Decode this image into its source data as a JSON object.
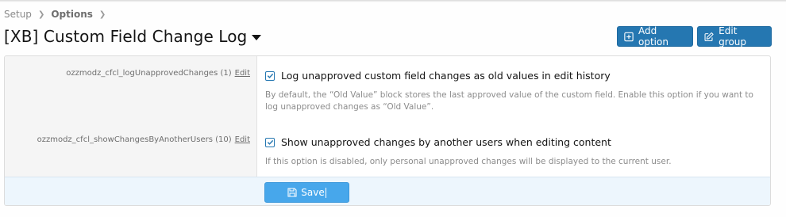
{
  "breadcrumb": {
    "items": [
      "Setup",
      "Options"
    ]
  },
  "header": {
    "title": "[XB] Custom Field Change Log"
  },
  "actions": {
    "add_option": "Add option",
    "edit_group": "Edit group"
  },
  "options": [
    {
      "key": "ozzmodz_cfcl_logUnapprovedChanges (1)",
      "edit_label": "Edit",
      "checked": true,
      "label": "Log unapproved custom field changes as old values in edit history",
      "explain": "By default, the “Old Value” block stores the last approved value of the custom field. Enable this option if you want to log unapproved changes as “Old Value”."
    },
    {
      "key": "ozzmodz_cfcl_showChangesByAnotherUsers (10)",
      "edit_label": "Edit",
      "checked": true,
      "label": "Show unapproved changes by another users when editing content",
      "explain": "If this option is disabled, only personal unapproved changes will be displayed to the current user."
    }
  ],
  "footer": {
    "save_label": "Save"
  },
  "colors": {
    "primary": "#2577b1",
    "save": "#47a7eb",
    "footer_bg": "#edf6fd",
    "label_bg": "#f5f5f5"
  },
  "icons": {
    "breadcrumb_separator": "chevron-right-icon",
    "title_menu": "caret-down-icon",
    "add_option": "plus-square-icon",
    "edit_group": "edit-icon",
    "save": "floppy-disk-icon",
    "checkbox": "check-icon"
  }
}
